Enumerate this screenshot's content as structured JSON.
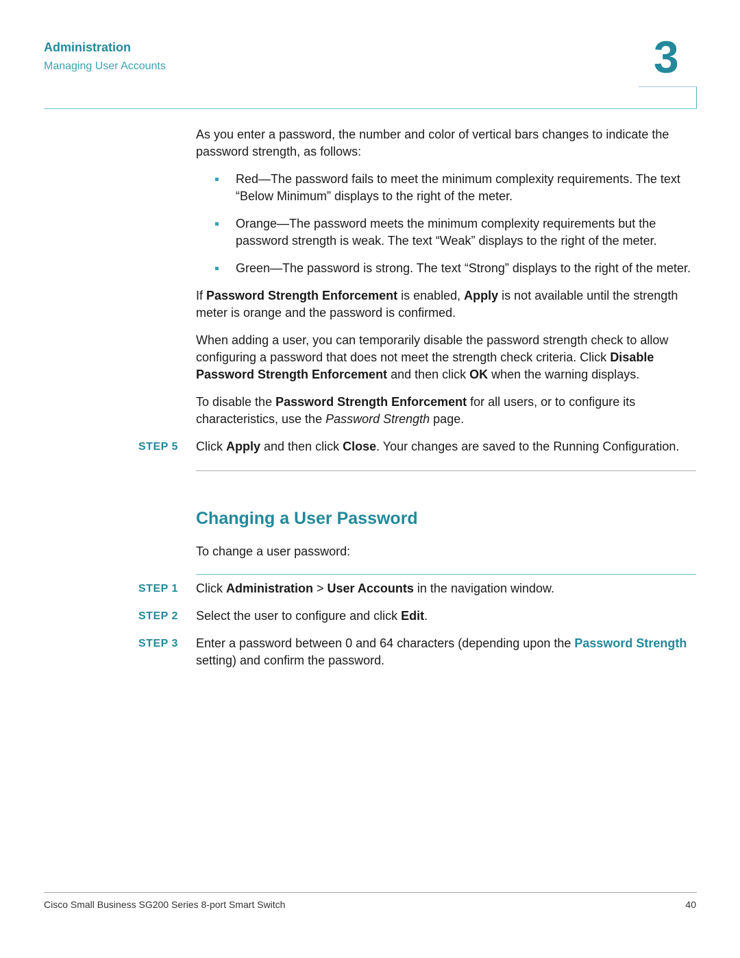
{
  "header": {
    "section": "Administration",
    "subsection": "Managing User Accounts",
    "chapter_number": "3"
  },
  "intro": {
    "p1": "As you enter a password, the number and color of vertical bars changes to indicate the password strength, as follows:",
    "bullets": [
      "Red—The password fails to meet the minimum complexity requirements. The text “Below Minimum” displays to the right of the meter.",
      "Orange—The password meets the minimum complexity requirements but the password strength is weak. The text “Weak” displays to the right of the meter.",
      "Green—The password is strong. The text “Strong” displays to the right of the meter."
    ],
    "p2": {
      "a": "If ",
      "b": "Password Strength Enforcement",
      "c": " is enabled, ",
      "d": "Apply",
      "e": " is not available until the strength meter is orange and the password is confirmed."
    },
    "p3": {
      "a": "When adding a user, you can temporarily disable the password strength check to allow configuring a password that does not meet the strength check criteria. Click ",
      "b": "Disable Password Strength Enforcement",
      "c": " and then click ",
      "d": "OK",
      "e": " when the warning displays."
    },
    "p4": {
      "a": "To disable the ",
      "b": "Password Strength Enforcement",
      "c": " for all users, or to configure its characteristics, use the ",
      "d": "Password Strength",
      "e": " page."
    },
    "step5": {
      "label": "STEP  5",
      "a": "Click ",
      "b": "Apply",
      "c": " and then click ",
      "d": "Close",
      "e": ". Your changes are saved to the Running Configuration."
    }
  },
  "section2": {
    "title": "Changing a User Password",
    "lead": "To change a user password:",
    "step1": {
      "label": "STEP  1",
      "a": "Click ",
      "b": "Administration",
      "c": " > ",
      "d": "User Accounts",
      "e": " in the navigation window."
    },
    "step2": {
      "label": "STEP  2",
      "a": "Select the user to configure and click ",
      "b": "Edit",
      "c": "."
    },
    "step3": {
      "label": "STEP  3",
      "a": "Enter a password between 0 and 64 characters (depending upon the ",
      "b": "Password Strength",
      "c": " setting) and confirm the password."
    }
  },
  "footer": {
    "title": "Cisco Small Business SG200 Series 8-port Smart Switch",
    "page": "40"
  }
}
